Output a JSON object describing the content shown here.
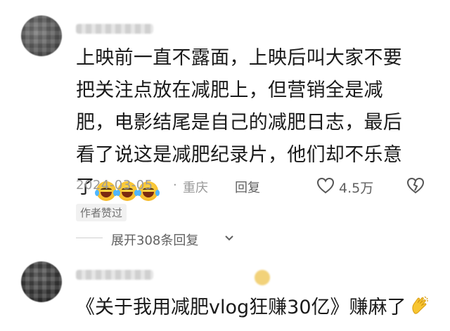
{
  "comment1": {
    "text": "上映前一直不露面，上映后叫大家不要把关注点放在减肥上，但营销全是减肥，电影结尾是自己的减肥日志，最后看了说这是减肥纪录片，他们却不乐意了",
    "emojis": [
      "laughing-crying-emoji",
      "laughing-crying-emoji",
      "laughing-crying-emoji"
    ],
    "date": "2024-03-05",
    "separator": "·",
    "location": "重庆",
    "reply_label": "回复",
    "like_count": "4.5万",
    "like_icon": "heart-outline-icon",
    "dislike_icon": "broken-heart-icon",
    "author_badge": "作者赞过",
    "expand_label": "展开308条回复"
  },
  "comment2": {
    "text": "《关于我用减肥vlog狂赚30亿》赚麻了",
    "emoji": "clapping-hands-emoji"
  },
  "colors": {
    "text": "#1a1a1a",
    "meta": "#9a9a9a",
    "secondary": "#606060",
    "badge_bg": "#f1f1f1"
  }
}
